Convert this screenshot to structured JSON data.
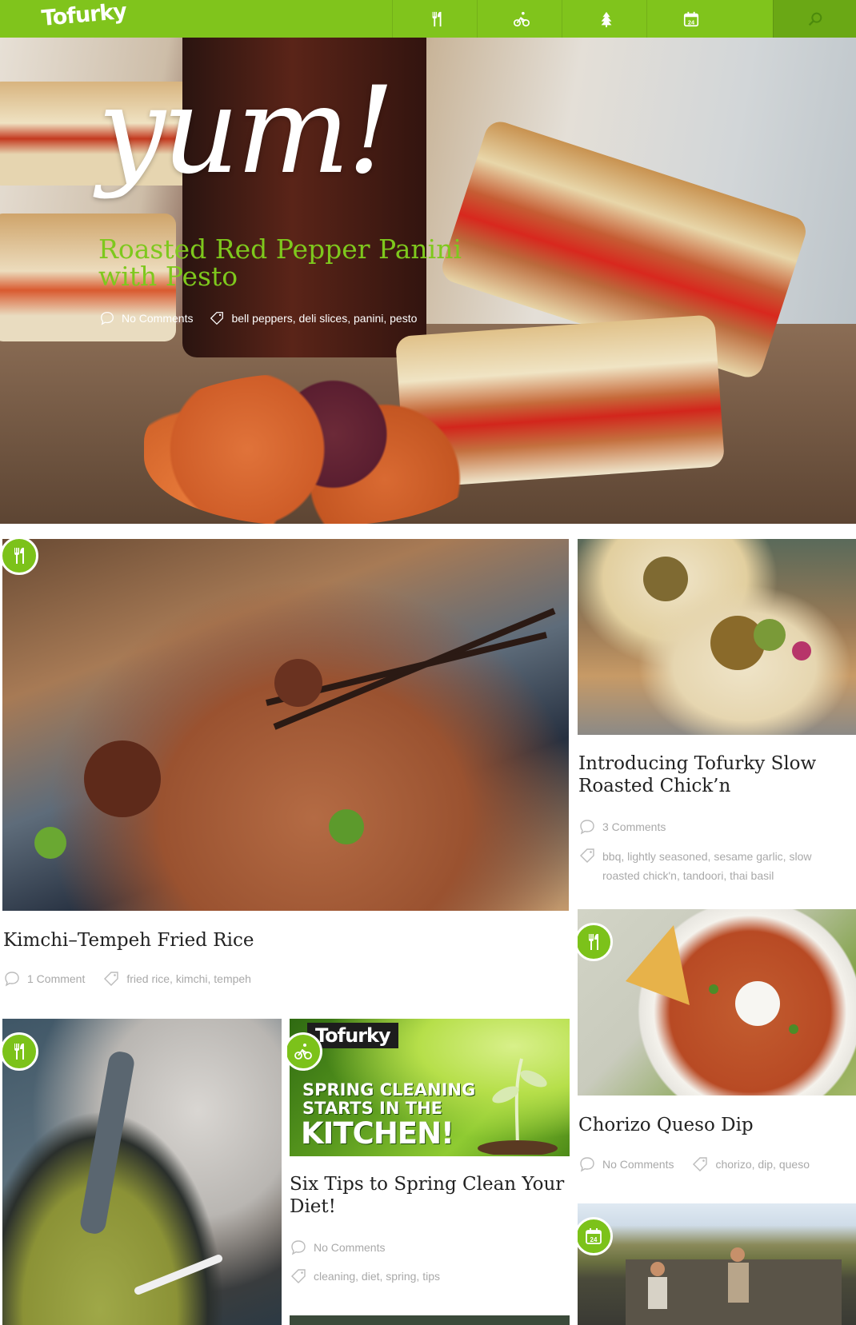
{
  "header": {
    "logo": "Tofurky",
    "nav": [
      {
        "icon": "fork-knife-icon"
      },
      {
        "icon": "cyclist-icon"
      },
      {
        "icon": "tree-icon"
      },
      {
        "icon": "calendar-icon",
        "text": "24"
      },
      {
        "icon": "search-icon"
      }
    ]
  },
  "hero": {
    "script": "yum!",
    "title": "Roasted Red Pepper Panini with Pesto",
    "comments": "No Comments",
    "tags": "bell peppers, deli slices, panini, pesto"
  },
  "posts": [
    {
      "title": "Kimchi–Tempeh Fried Rice",
      "comments": "1 Comment",
      "tags": "fried rice, kimchi, tempeh",
      "category_icon": "fork-knife-icon"
    },
    {
      "title": "Introducing Tofurky Slow Roasted Chick’n",
      "comments": "3 Comments",
      "tags": "bbq, lightly seasoned, sesame garlic, slow roasted chick'n, tandoori, thai basil"
    },
    {
      "title": "Chorizo Queso Dip",
      "comments": "No Comments",
      "tags": "chorizo, dip, queso",
      "category_icon": "fork-knife-icon"
    },
    {
      "title": "Six Tips to Spring Clean Your Diet!",
      "comments": "No Comments",
      "tags": "cleaning, diet, spring, tips",
      "category_icon": "cyclist-icon"
    },
    {
      "title": "",
      "category_icon": "fork-knife-icon"
    },
    {
      "title": "",
      "category_icon": "calendar-icon",
      "badge_text": "24"
    }
  ],
  "promo": {
    "brand": "Tofurky",
    "line1": "SPRING CLEANING",
    "line2": "STARTS IN THE",
    "line3": "KITCHEN!"
  },
  "colors": {
    "brand_green": "#80c41c",
    "title_green": "#7ec81d",
    "meta_gray": "#a9a9a9"
  }
}
